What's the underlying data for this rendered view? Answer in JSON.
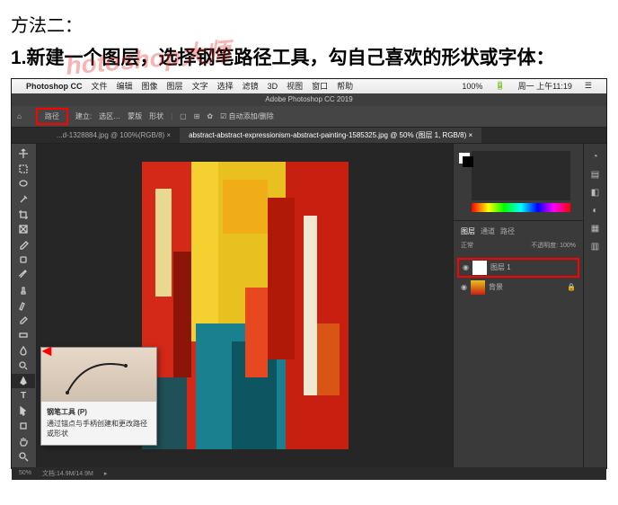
{
  "article": {
    "method_title": "方法二：",
    "step_text": "1.新建一个图层，选择钢笔路径工具，勾自己喜欢的形状或字体：",
    "watermark": "hotoshop大师"
  },
  "mac_menubar": {
    "apple": "",
    "app": "Photoshop CC",
    "items": [
      "文件",
      "编辑",
      "图像",
      "图层",
      "文字",
      "选择",
      "滤镜",
      "3D",
      "视图",
      "窗口",
      "帮助"
    ],
    "status_right": "100%",
    "day_time": "周一 上午11:19"
  },
  "window_title": "Adobe Photoshop CC 2019",
  "option_bar": {
    "highlighted": "路径",
    "items": [
      "建立:",
      "选区…",
      "蒙版",
      "形状"
    ],
    "auto": "☑ 自动添加/删除"
  },
  "tabs": {
    "tab1": "...d-1328884.jpg @ 100%(RGB/8) ×",
    "tab2": "abstract-abstract-expressionism-abstract-painting-1585325.jpg @ 50% (图层 1, RGB/8) ×"
  },
  "layers_panel": {
    "tabs": [
      "图层",
      "通道",
      "路径"
    ],
    "mode": "正常",
    "opacity_label": "不透明度:",
    "opacity": "100%",
    "layer1": "图层 1",
    "bg": "背景"
  },
  "tooltip": {
    "title": "钢笔工具 (P)",
    "desc": "通过锚点与手柄创建和更改路径或形状"
  },
  "status_bar": {
    "zoom": "50%",
    "doc": "文档:14.9M/14.9M"
  }
}
